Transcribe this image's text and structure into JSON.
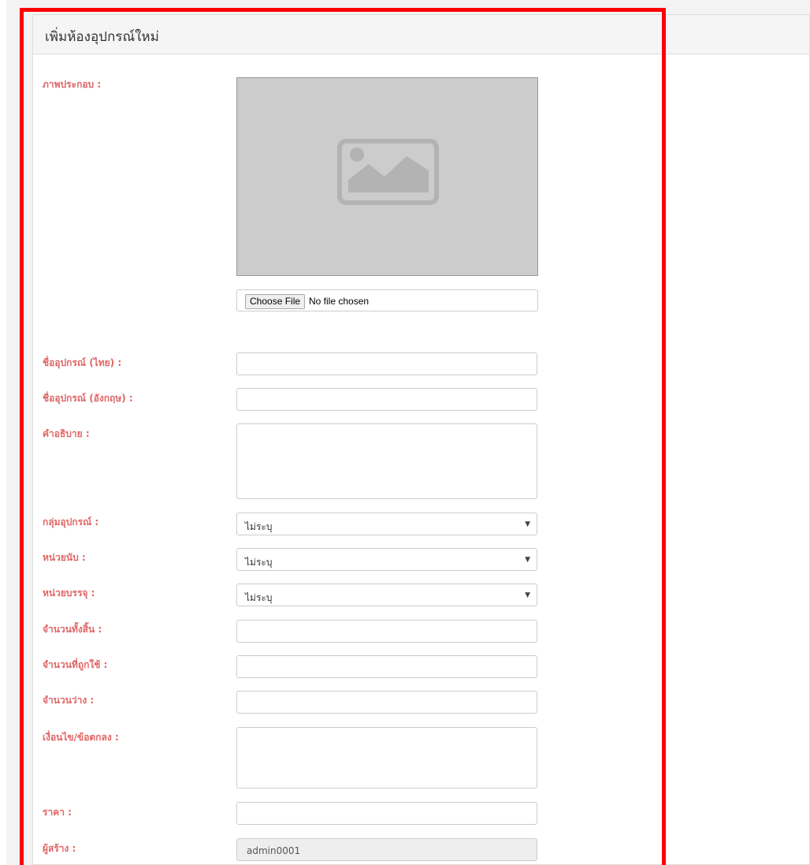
{
  "panel": {
    "title": "เพิ่มห้องอุปกรณ์ใหม่"
  },
  "image": {
    "label": "ภาพประกอบ :",
    "preview_icon": "image-placeholder-icon",
    "choose_button": "Choose File",
    "file_status": "No file chosen"
  },
  "fields": {
    "name_th": {
      "label": "ชื่ออุปกรณ์ (ไทย) :",
      "value": ""
    },
    "name_en": {
      "label": "ชื่ออุปกรณ์ (อังกฤษ) :",
      "value": ""
    },
    "description": {
      "label": "คำอธิบาย :",
      "value": ""
    },
    "group": {
      "label": "กลุ่มอุปกรณ์ :",
      "selected": "ไม่ระบุ"
    },
    "unit": {
      "label": "หน่วยนับ :",
      "selected": "ไม่ระบุ"
    },
    "package_unit": {
      "label": "หน่วยบรรจุ :",
      "selected": "ไม่ระบุ"
    },
    "total": {
      "label": "จำนวนทั้งสิ้น :",
      "value": ""
    },
    "used": {
      "label": "จำนวนที่ถูกใช้ :",
      "value": ""
    },
    "available": {
      "label": "จำนวนว่าง :",
      "value": ""
    },
    "conditions": {
      "label": "เงื่อนไข/ข้อตกลง :",
      "value": ""
    },
    "price": {
      "label": "ราคา :",
      "value": ""
    },
    "creator": {
      "label": "ผู้สร้าง :",
      "value": "admin0001"
    }
  },
  "colors": {
    "label": "#e06666",
    "highlight": "#ff0000",
    "preview_bg": "#cccccc"
  }
}
